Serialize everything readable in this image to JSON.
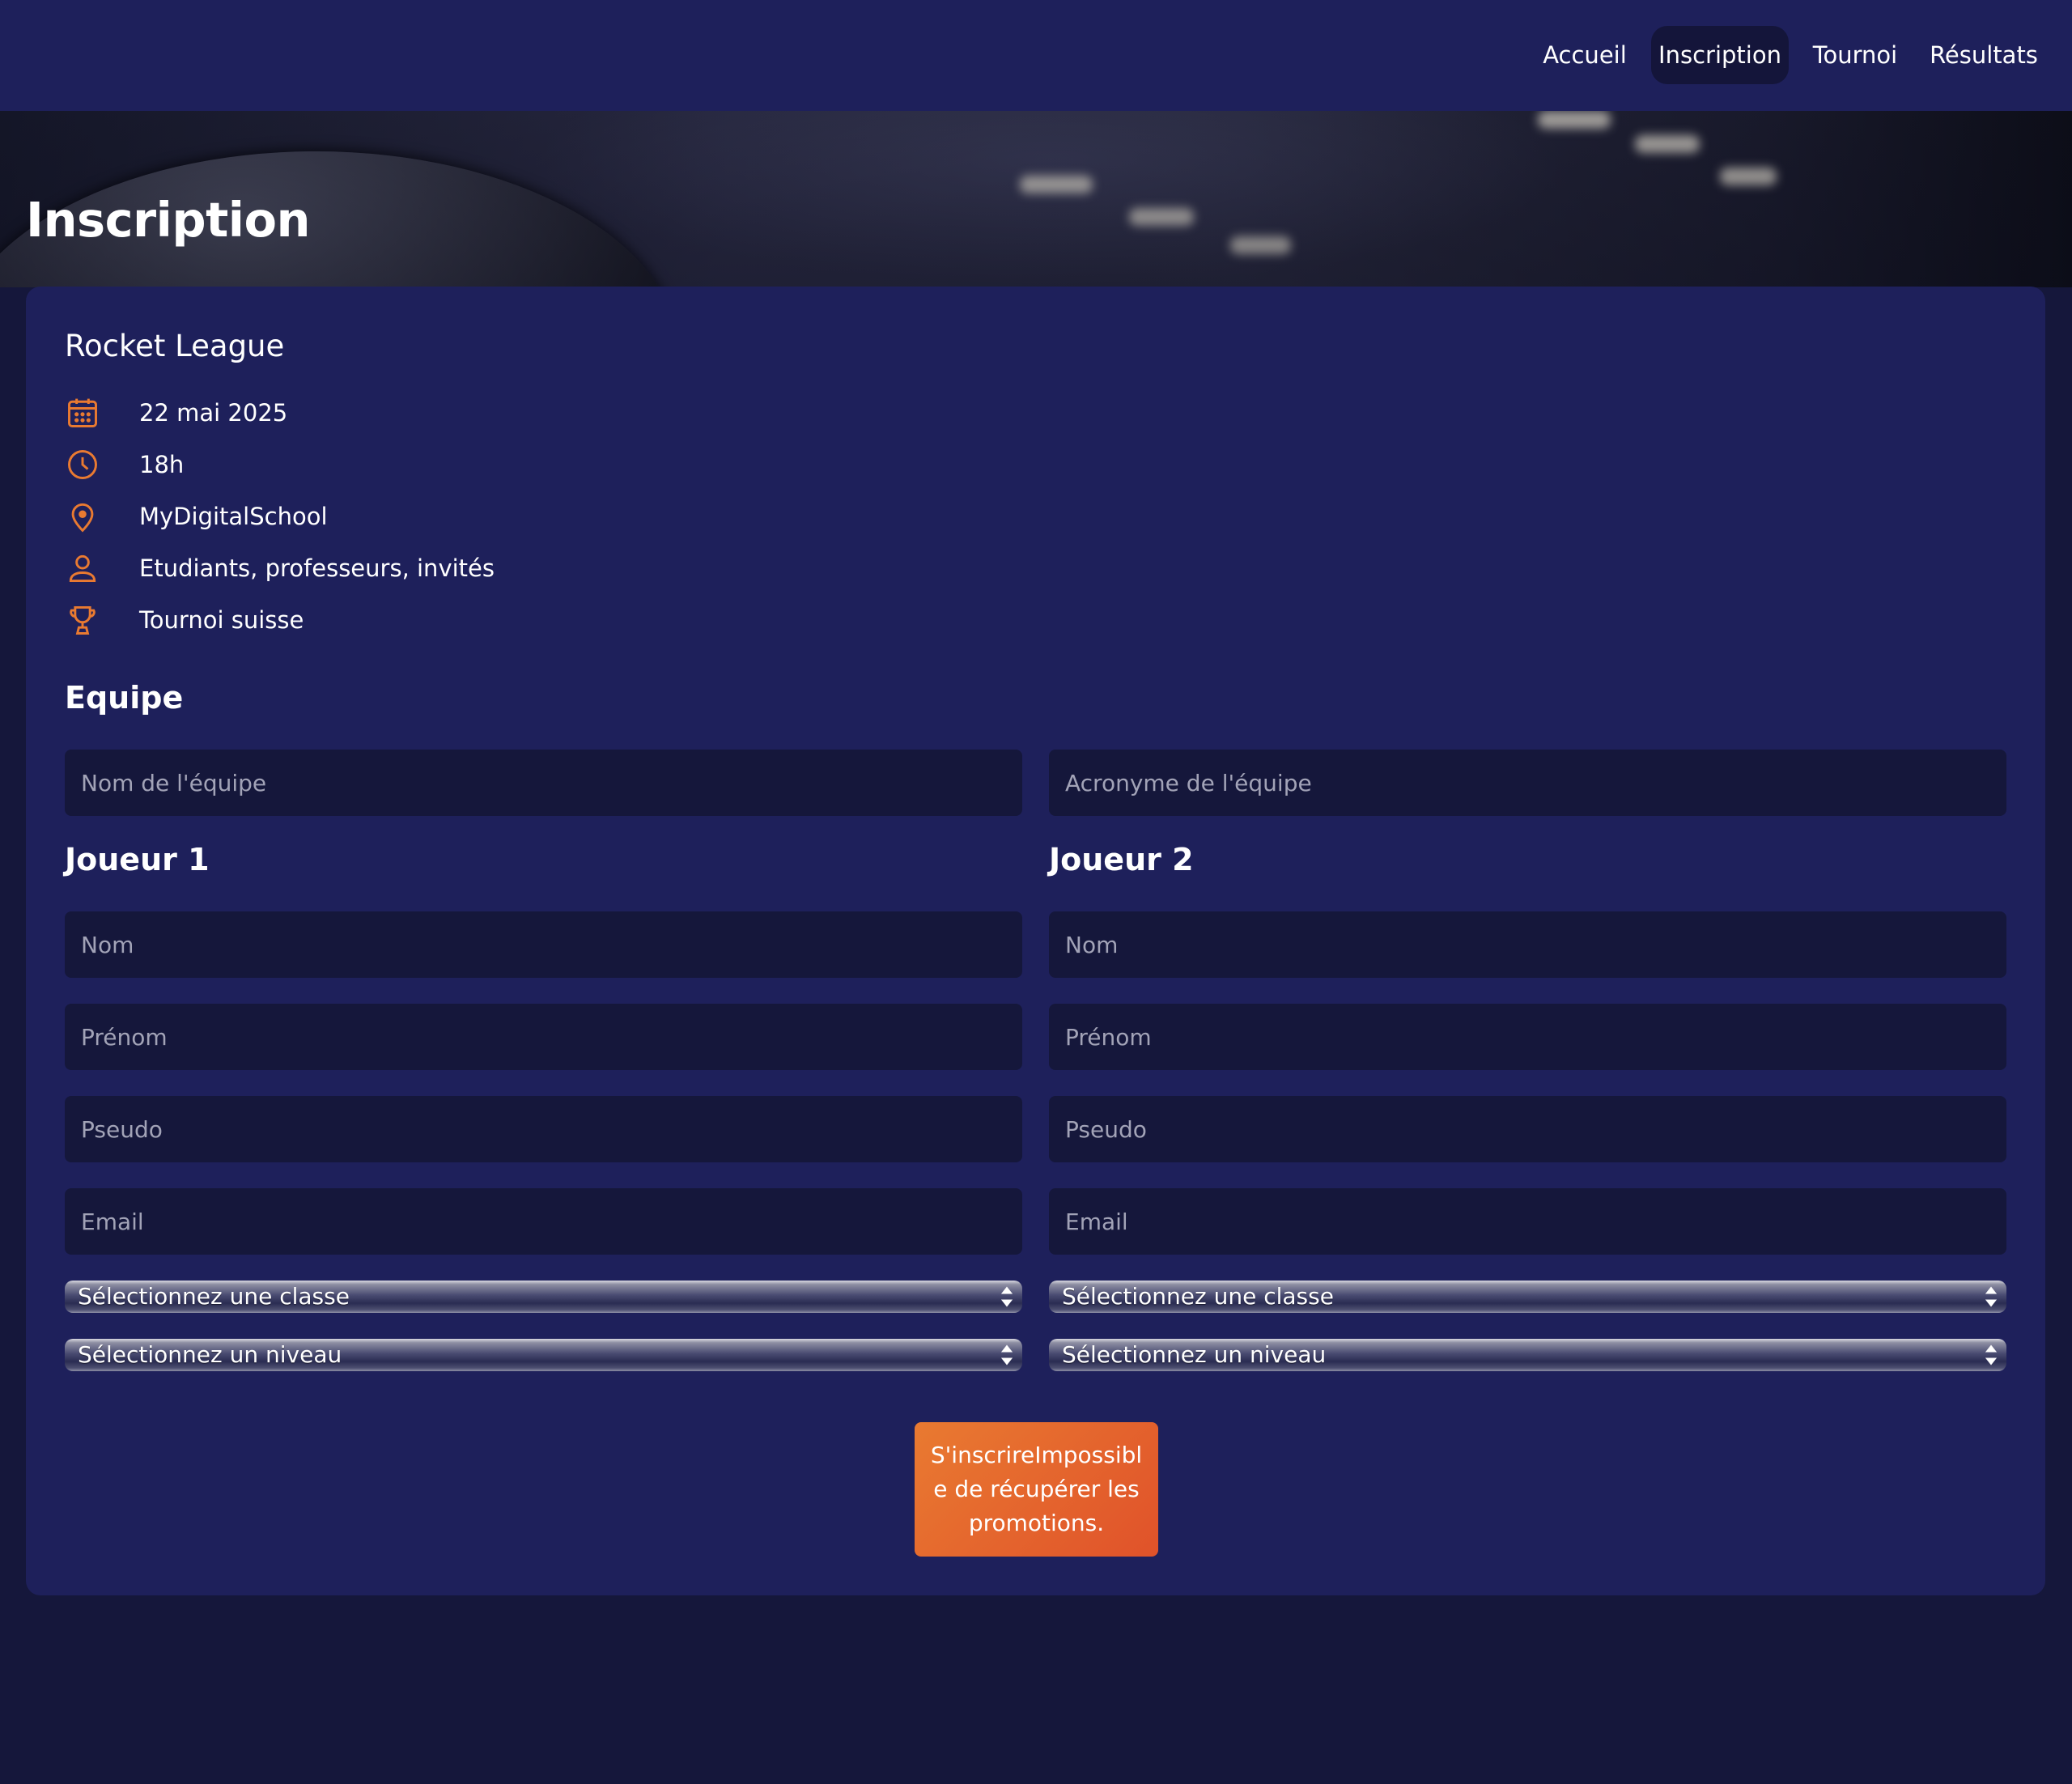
{
  "nav": {
    "items": [
      {
        "label": "Accueil",
        "active": false
      },
      {
        "label": "Inscription",
        "active": true
      },
      {
        "label": "Tournoi",
        "active": false
      },
      {
        "label": "Résultats",
        "active": false
      }
    ]
  },
  "hero": {
    "title": "Inscription"
  },
  "event": {
    "title": "Rocket League",
    "date": "22 mai 2025",
    "time": "18h",
    "location": "MyDigitalSchool",
    "audience": "Etudiants, professeurs, invités",
    "format": "Tournoi suisse"
  },
  "team": {
    "heading": "Equipe",
    "name_placeholder": "Nom de l'équipe",
    "acronym_placeholder": "Acronyme de l'équipe"
  },
  "players": [
    {
      "heading": "Joueur 1",
      "nom_placeholder": "Nom",
      "prenom_placeholder": "Prénom",
      "pseudo_placeholder": "Pseudo",
      "email_placeholder": "Email",
      "classe_select": "Sélectionnez une classe",
      "niveau_select": "Sélectionnez un niveau"
    },
    {
      "heading": "Joueur 2",
      "nom_placeholder": "Nom",
      "prenom_placeholder": "Prénom",
      "pseudo_placeholder": "Pseudo",
      "email_placeholder": "Email",
      "classe_select": "Sélectionnez une classe",
      "niveau_select": "Sélectionnez un niveau"
    }
  ],
  "submit": {
    "label": "S'inscrireImpossible de récupérer les promotions."
  },
  "colors": {
    "nav_bg": "#1e205b",
    "card_bg": "#1e205b",
    "page_bg": "#15173b",
    "accent": "#e97a31",
    "accent_end": "#e0522a"
  },
  "icons": {
    "date": "calendar-icon",
    "time": "clock-icon",
    "location": "map-pin-icon",
    "audience": "user-icon",
    "format": "trophy-icon"
  }
}
